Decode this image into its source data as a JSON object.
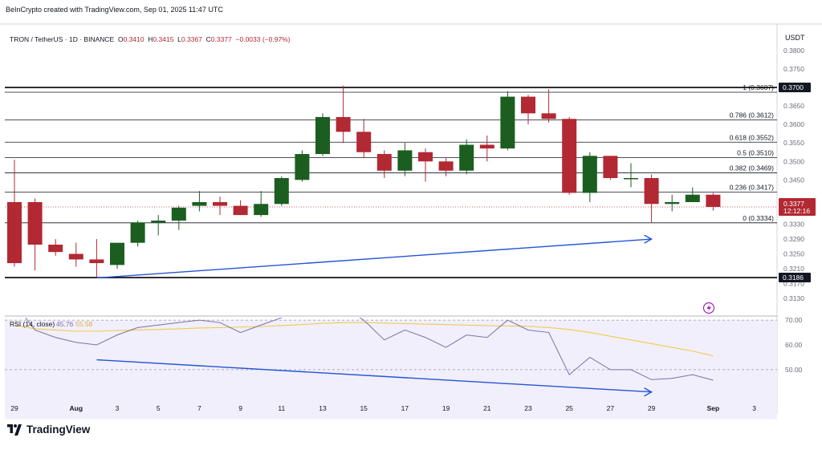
{
  "credit": "BeInCrypto created with TradingView.com, Sep 01, 2025 11:47 UTC",
  "symbol": {
    "title": "TRON / TetherUS · 1D · BINANCE",
    "open_label": "O",
    "open": "0.3410",
    "high_label": "H",
    "high": "0.3415",
    "low_label": "L",
    "low": "0.3367",
    "close_label": "C",
    "close": "0.3377",
    "change": "−0.0033 (−0.97%)"
  },
  "currency": "USDT",
  "brand": "TradingView",
  "colors": {
    "up": "#1b5e20",
    "down": "#b22833",
    "fib": "#131722",
    "trend": "#2454d6",
    "rsi": "#7e6fa6",
    "rsi_ma": "#f2c94c",
    "rsi_bg": "#f1effb"
  },
  "chart_data": {
    "type": "candlestick",
    "price_axis": {
      "ylim": [
        0.3095,
        0.3815
      ],
      "ticks": [
        "0.3800",
        "0.3750",
        "0.3650",
        "0.3600",
        "0.3550",
        "0.3500",
        "0.3450",
        "0.3390",
        "0.3330",
        "0.3290",
        "0.3250",
        "0.3210",
        "0.3170",
        "0.3130"
      ]
    },
    "x_axis_labels": [
      "29",
      "Aug",
      "3",
      "5",
      "7",
      "9",
      "11",
      "13",
      "15",
      "17",
      "19",
      "21",
      "23",
      "25",
      "27",
      "29",
      "Sep",
      "3"
    ],
    "candles": [
      {
        "date": "Jul 29",
        "o": 0.339,
        "h": 0.3505,
        "l": 0.3215,
        "c": 0.3225
      },
      {
        "date": "Jul 30",
        "o": 0.339,
        "h": 0.34,
        "l": 0.3205,
        "c": 0.3275
      },
      {
        "date": "Jul 31",
        "o": 0.3275,
        "h": 0.329,
        "l": 0.3245,
        "c": 0.3255
      },
      {
        "date": "Aug 1",
        "o": 0.325,
        "h": 0.328,
        "l": 0.3215,
        "c": 0.3235
      },
      {
        "date": "Aug 2",
        "o": 0.3235,
        "h": 0.329,
        "l": 0.3185,
        "c": 0.3225
      },
      {
        "date": "Aug 3",
        "o": 0.322,
        "h": 0.328,
        "l": 0.321,
        "c": 0.328
      },
      {
        "date": "Aug 4",
        "o": 0.328,
        "h": 0.334,
        "l": 0.327,
        "c": 0.3335
      },
      {
        "date": "Aug 5",
        "o": 0.3335,
        "h": 0.3355,
        "l": 0.33,
        "c": 0.334
      },
      {
        "date": "Aug 6",
        "o": 0.334,
        "h": 0.338,
        "l": 0.3315,
        "c": 0.3375
      },
      {
        "date": "Aug 7",
        "o": 0.338,
        "h": 0.342,
        "l": 0.3365,
        "c": 0.339
      },
      {
        "date": "Aug 8",
        "o": 0.339,
        "h": 0.3405,
        "l": 0.3355,
        "c": 0.338
      },
      {
        "date": "Aug 9",
        "o": 0.338,
        "h": 0.3395,
        "l": 0.3355,
        "c": 0.3355
      },
      {
        "date": "Aug 10",
        "o": 0.3355,
        "h": 0.342,
        "l": 0.335,
        "c": 0.3385
      },
      {
        "date": "Aug 11",
        "o": 0.3385,
        "h": 0.346,
        "l": 0.338,
        "c": 0.3455
      },
      {
        "date": "Aug 12",
        "o": 0.345,
        "h": 0.353,
        "l": 0.3445,
        "c": 0.352
      },
      {
        "date": "Aug 13",
        "o": 0.352,
        "h": 0.363,
        "l": 0.3515,
        "c": 0.362
      },
      {
        "date": "Aug 14",
        "o": 0.362,
        "h": 0.3705,
        "l": 0.355,
        "c": 0.358
      },
      {
        "date": "Aug 15",
        "o": 0.358,
        "h": 0.3615,
        "l": 0.351,
        "c": 0.3525
      },
      {
        "date": "Aug 16",
        "o": 0.352,
        "h": 0.353,
        "l": 0.3455,
        "c": 0.3475
      },
      {
        "date": "Aug 17",
        "o": 0.3475,
        "h": 0.355,
        "l": 0.346,
        "c": 0.353
      },
      {
        "date": "Aug 18",
        "o": 0.3525,
        "h": 0.3535,
        "l": 0.3445,
        "c": 0.35
      },
      {
        "date": "Aug 19",
        "o": 0.35,
        "h": 0.351,
        "l": 0.346,
        "c": 0.3475
      },
      {
        "date": "Aug 20",
        "o": 0.3475,
        "h": 0.356,
        "l": 0.3465,
        "c": 0.3545
      },
      {
        "date": "Aug 21",
        "o": 0.3545,
        "h": 0.357,
        "l": 0.35,
        "c": 0.3535
      },
      {
        "date": "Aug 22",
        "o": 0.3535,
        "h": 0.369,
        "l": 0.353,
        "c": 0.3675
      },
      {
        "date": "Aug 23",
        "o": 0.3675,
        "h": 0.368,
        "l": 0.36,
        "c": 0.363
      },
      {
        "date": "Aug 24",
        "o": 0.363,
        "h": 0.3695,
        "l": 0.3605,
        "c": 0.3615
      },
      {
        "date": "Aug 25",
        "o": 0.3615,
        "h": 0.362,
        "l": 0.341,
        "c": 0.3415
      },
      {
        "date": "Aug 26",
        "o": 0.3415,
        "h": 0.3525,
        "l": 0.339,
        "c": 0.3515
      },
      {
        "date": "Aug 27",
        "o": 0.3515,
        "h": 0.3515,
        "l": 0.345,
        "c": 0.3455
      },
      {
        "date": "Aug 28",
        "o": 0.3455,
        "h": 0.3495,
        "l": 0.343,
        "c": 0.3455
      },
      {
        "date": "Aug 29",
        "o": 0.3455,
        "h": 0.3465,
        "l": 0.3335,
        "c": 0.3385
      },
      {
        "date": "Aug 30",
        "o": 0.3385,
        "h": 0.341,
        "l": 0.3365,
        "c": 0.339
      },
      {
        "date": "Aug 31",
        "o": 0.339,
        "h": 0.343,
        "l": 0.339,
        "c": 0.341
      },
      {
        "date": "Sep 1",
        "o": 0.341,
        "h": 0.3415,
        "l": 0.3367,
        "c": 0.3377
      }
    ],
    "fib_levels": [
      {
        "label": "1 (0.3687)",
        "value": 0.3687
      },
      {
        "label": "0.786 (0.3612)",
        "value": 0.3612
      },
      {
        "label": "0.618 (0.3552)",
        "value": 0.3552
      },
      {
        "label": "0.5 (0.3510)",
        "value": 0.351
      },
      {
        "label": "0.382 (0.3469)",
        "value": 0.3469
      },
      {
        "label": "0.236 (0.3417)",
        "value": 0.3417
      },
      {
        "label": "0 (0.3334)",
        "value": 0.3334
      }
    ],
    "horizontal_lines": [
      {
        "label": "0.3700",
        "value": 0.37
      },
      {
        "label": "0.3186",
        "value": 0.3186
      }
    ],
    "current_price": {
      "value": 0.3377,
      "label": "0.3377",
      "countdown": "12:12:16"
    },
    "price_trendline": {
      "from": {
        "date": "Aug 2",
        "price": 0.3185
      },
      "to": {
        "date": "Aug 29",
        "price": 0.329
      }
    },
    "rsi": {
      "legend": "RSI (14, close)",
      "value": "45.76",
      "ma_value": "55.58",
      "ylim": [
        38,
        71
      ],
      "ticks": [
        "70.00",
        "60.00",
        "50.00"
      ],
      "midline": 50,
      "rsi_values": [
        77,
        66,
        63,
        61,
        60,
        64,
        67,
        68,
        69,
        70,
        69,
        65,
        68,
        71,
        74,
        77,
        75,
        70,
        62,
        66,
        63,
        59,
        64,
        63,
        70,
        66,
        65,
        48,
        55,
        50,
        50,
        46,
        46.5,
        48,
        45.76
      ],
      "ma_values": [
        68,
        66.5,
        66,
        65.5,
        65.5,
        65.8,
        66,
        66.2,
        66.5,
        66.8,
        67,
        67.2,
        67.4,
        67.8,
        68.2,
        68.7,
        69,
        69,
        68.8,
        68.6,
        68.4,
        68.2,
        68,
        67.8,
        67.6,
        67.5,
        67,
        66.2,
        65,
        63.5,
        62,
        60.5,
        59,
        57.5,
        55.58
      ],
      "trendline": {
        "from": {
          "date": "Aug 2",
          "rsi": 54
        },
        "to": {
          "date": "Aug 29",
          "rsi": 41
        }
      }
    }
  }
}
